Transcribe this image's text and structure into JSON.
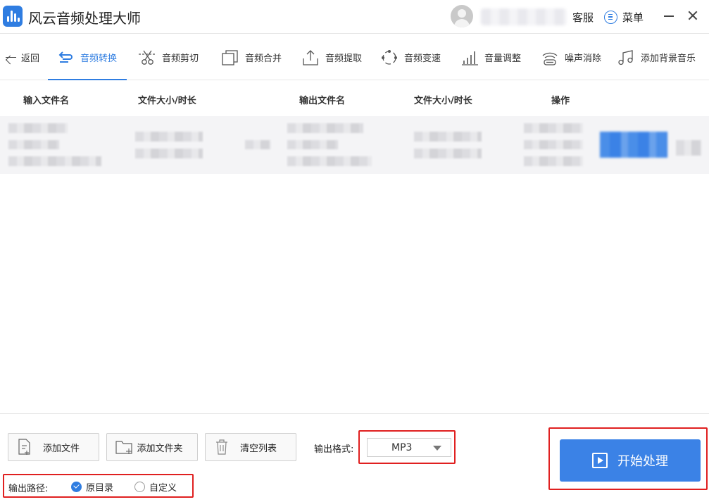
{
  "app": {
    "title": "风云音频处理大师"
  },
  "header": {
    "service": "客服",
    "menu": "菜单"
  },
  "toolbar": {
    "back": "返回",
    "tabs": [
      "音频转换",
      "音频剪切",
      "音频合并",
      "音频提取",
      "音频变速",
      "音量调整",
      "噪声消除",
      "添加背景音乐"
    ]
  },
  "table": {
    "columns": [
      "输入文件名",
      "文件大小/时长",
      "输出文件名",
      "文件大小/时长",
      "操作"
    ]
  },
  "controls": {
    "add_file": "添加文件",
    "add_folder": "添加文件夹",
    "clear_list": "清空列表",
    "format_label": "输出格式:",
    "format_value": "MP3",
    "path_label": "输出路径:",
    "path_original": "原目录",
    "path_custom": "自定义",
    "start": "开始处理"
  },
  "colors": {
    "accent": "#2f7de1",
    "button": "#3b82e6",
    "highlight": "#e02020"
  }
}
